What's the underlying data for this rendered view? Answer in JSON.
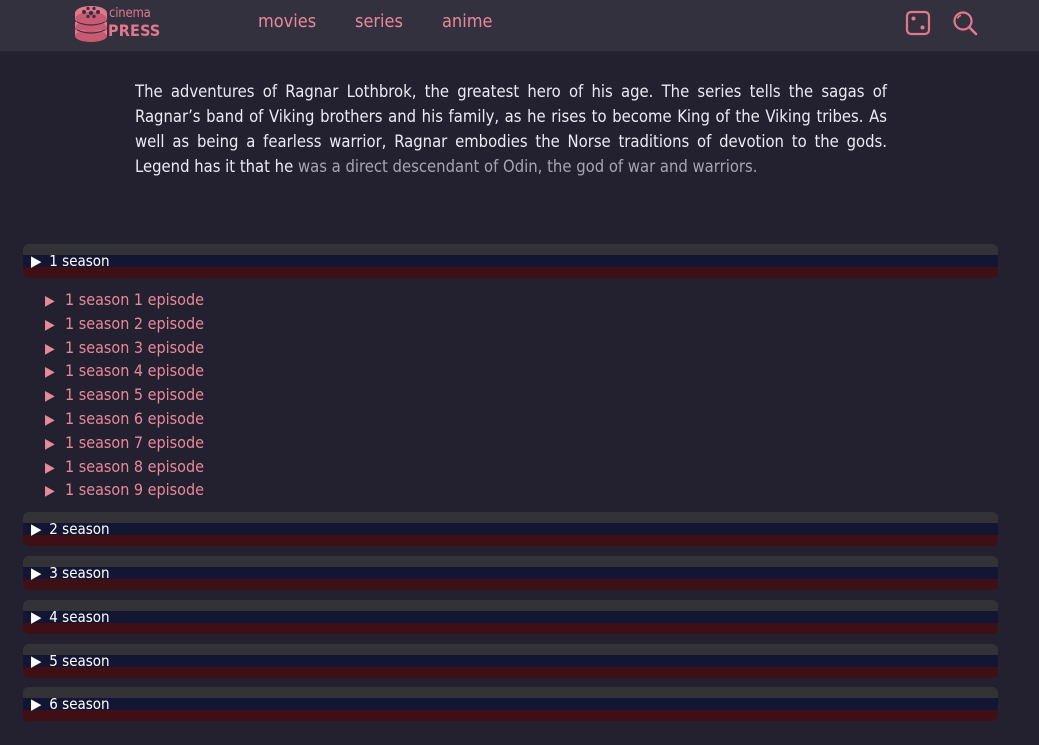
{
  "header": {
    "logo": {
      "line1": "cinema",
      "line2": "PRESS"
    },
    "nav": [
      {
        "label": "movies"
      },
      {
        "label": "series"
      },
      {
        "label": "anime"
      }
    ],
    "icons": [
      "dice-icon",
      "search-icon"
    ]
  },
  "description": {
    "main": "The adventures of Ragnar Lothbrok, the greatest hero of his age. The series tells the sagas of Ragnar’s band of Viking brothers and his family, as he rises to become King of the Viking tribes. As well as being a fearless warrior, Ragnar embodies the Norse traditions of devotion to the gods. Legend has it that he",
    "faded": "was a direct descendant of Odin, the god of war and warriors."
  },
  "seasons": [
    {
      "label": "1 season",
      "expanded": true
    },
    {
      "label": "2 season",
      "expanded": false
    },
    {
      "label": "3 season",
      "expanded": false
    },
    {
      "label": "4 season",
      "expanded": false
    },
    {
      "label": "5 season",
      "expanded": false
    },
    {
      "label": "6 season",
      "expanded": false
    }
  ],
  "episodes": [
    "1 season 1 episode",
    "1 season 2 episode",
    "1 season 3 episode",
    "1 season 4 episode",
    "1 season 5 episode",
    "1 season 6 episode",
    "1 season 7 episode",
    "1 season 8 episode",
    "1 season 9 episode"
  ],
  "colors": {
    "accent": "#e8889b",
    "background": "#232130",
    "topbar": "#34313f"
  },
  "glyphs": {
    "triangle": "▶"
  }
}
